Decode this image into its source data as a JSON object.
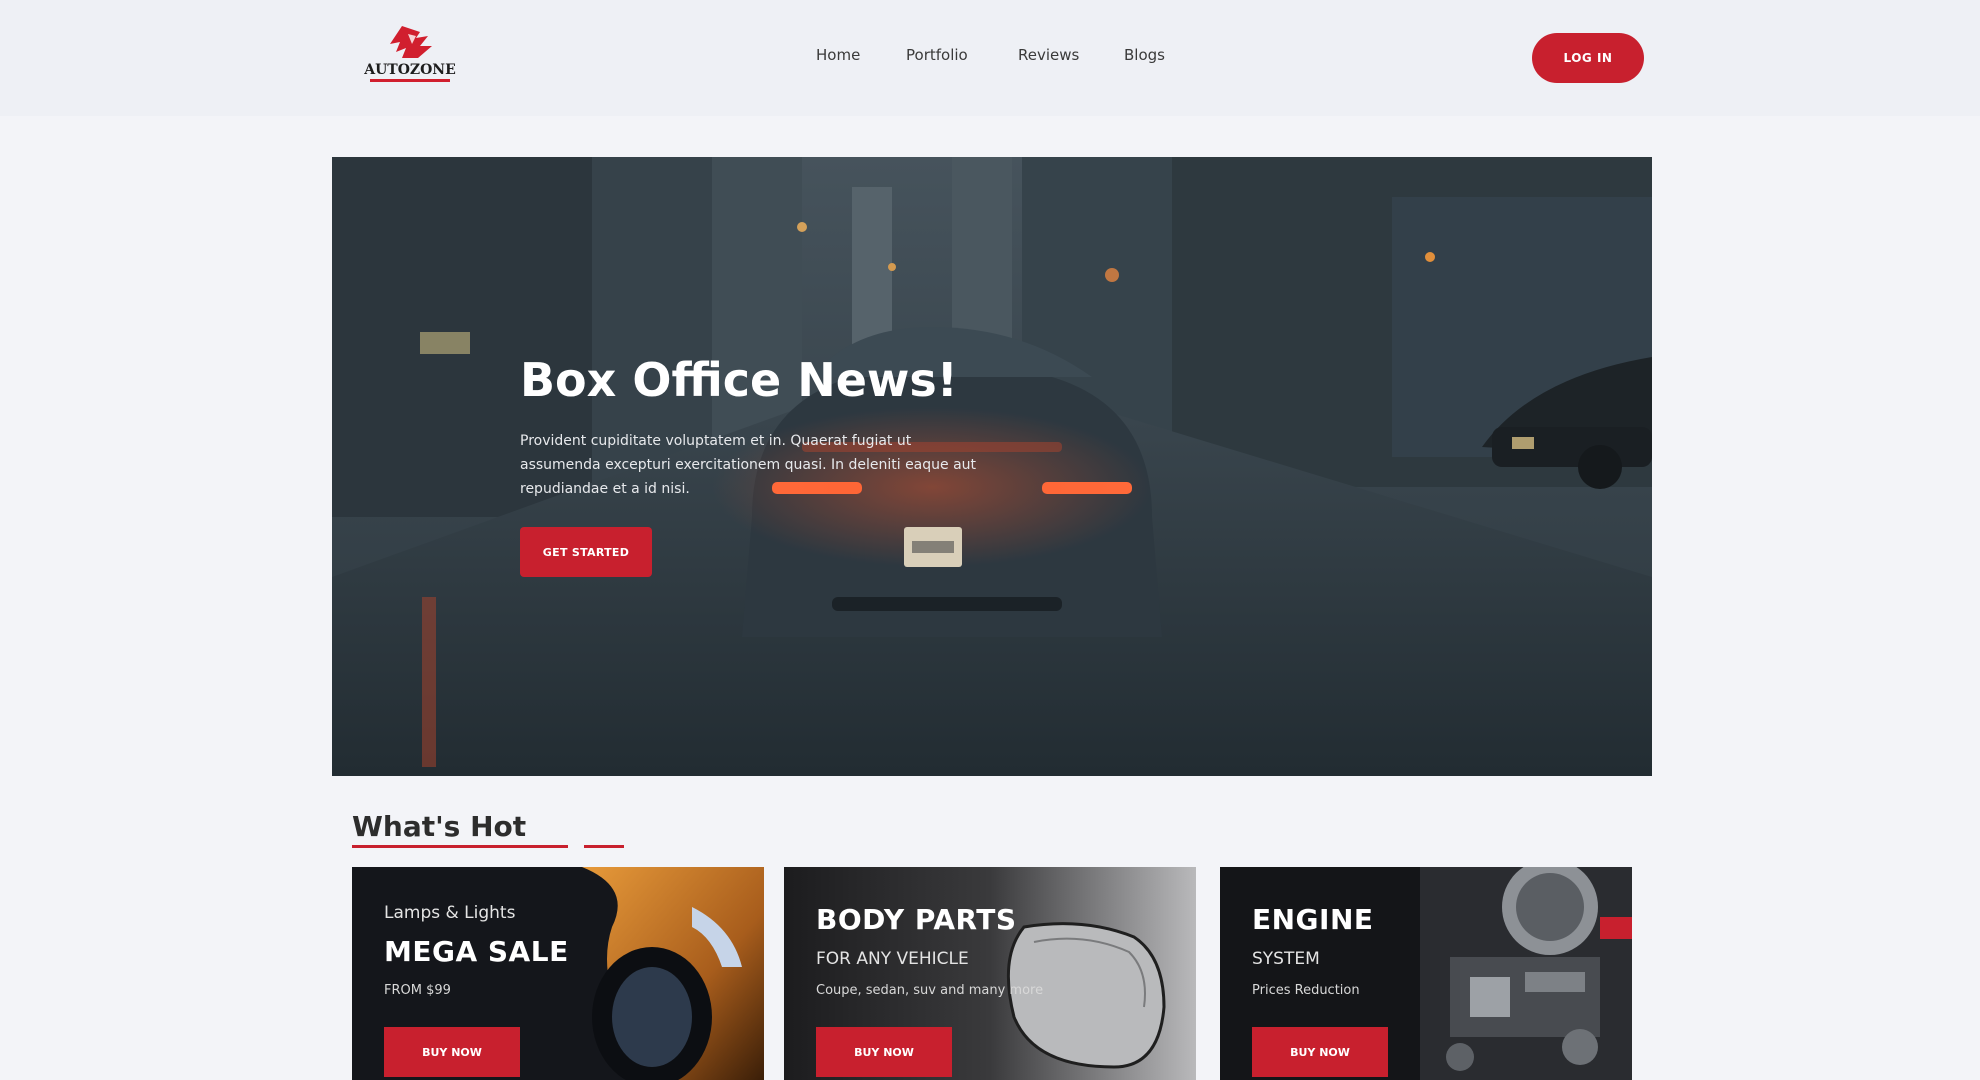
{
  "header": {
    "logo_text": "AUTOZONE",
    "nav": [
      {
        "label": "Home"
      },
      {
        "label": "Portfolio"
      },
      {
        "label": "Reviews"
      },
      {
        "label": "Blogs"
      }
    ],
    "login_label": "LOG IN"
  },
  "hero": {
    "title": "Box Office News!",
    "text": "Provident cupiditate voluptatem et in. Quaerat fugiat ut assumenda excepturi exercitationem quasi. In deleniti eaque aut repudiandae et a id nisi.",
    "button_label": "GET STARTED"
  },
  "section": {
    "title": "What's Hot"
  },
  "cards": [
    {
      "kicker": "Lamps & Lights",
      "heading": "MEGA SALE",
      "note": "FROM $99",
      "button_label": "BUY NOW"
    },
    {
      "heading": "BODY PARTS",
      "kicker": "FOR ANY VEHICLE",
      "note": "Coupe, sedan, suv and many more",
      "button_label": "BUY NOW"
    },
    {
      "heading": "ENGINE",
      "kicker": "SYSTEM",
      "note": "Prices Reduction",
      "button_label": "BUY NOW"
    }
  ],
  "colors": {
    "accent": "#c8202e",
    "header_bg": "#eef0f5",
    "page_bg": "#f3f4f8"
  }
}
